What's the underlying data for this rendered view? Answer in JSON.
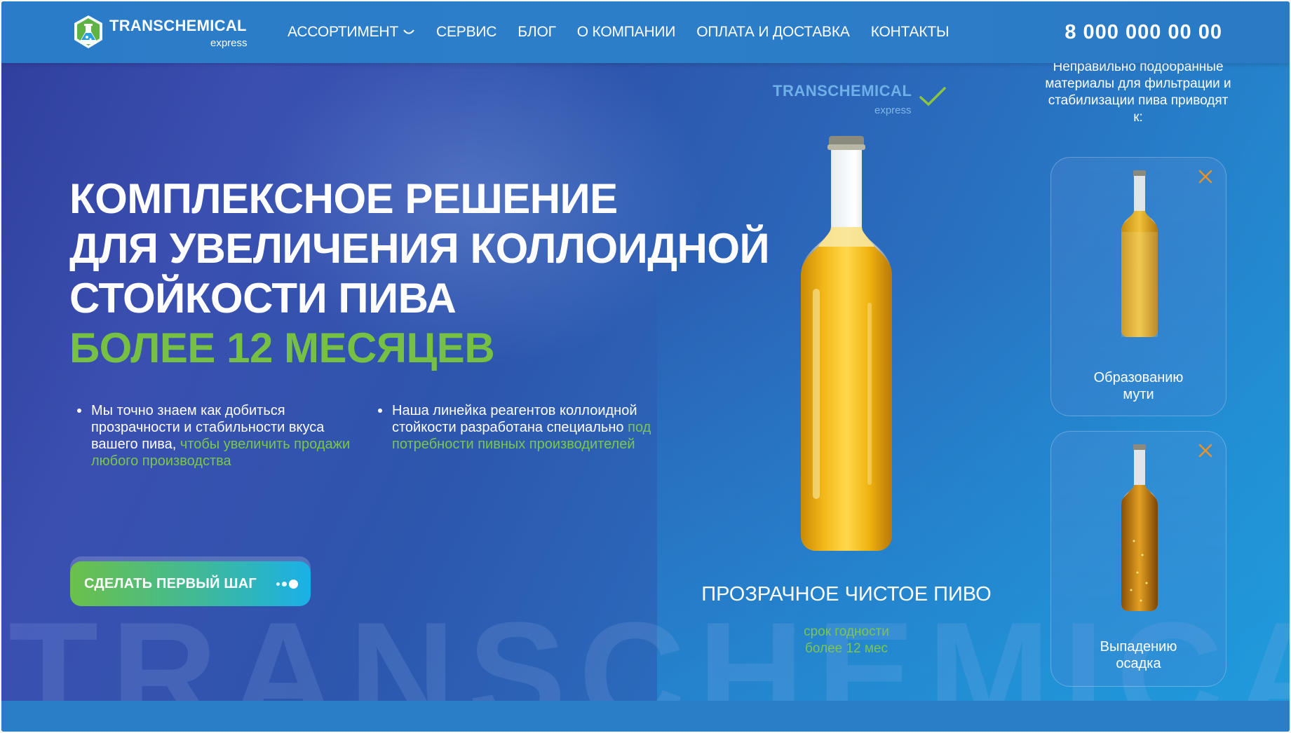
{
  "header": {
    "brand_name": "TRANSCHEMICAL",
    "brand_sub": "express",
    "nav": [
      {
        "label": "АССОРТИМЕНТ"
      },
      {
        "label": "СЕРВИС"
      },
      {
        "label": "БЛОГ"
      },
      {
        "label": "О КОМПАНИИ"
      },
      {
        "label": "ОПЛАТА И ДОСТАВКА"
      },
      {
        "label": "КОНТАКТЫ"
      }
    ],
    "phone": "8 000 000 00 00"
  },
  "hero": {
    "title_lines": [
      "КОМПЛЕКСНОЕ РЕШЕНИЕ",
      "ДЛЯ УВЕЛИЧЕНИЯ КОЛЛОИДНОЙ",
      "СТОЙКОСТИ ПИВА"
    ],
    "title_accent": "БОЛЕЕ 12 МЕСЯЦЕВ",
    "bullet1": {
      "text": "Мы точно знаем как добиться прозрачности и стабильности вкуса вашего пива,",
      "highlight": "чтобы увеличить продажи любого производства"
    },
    "bullet2": {
      "text": "Наша линейка реагентов коллоидной стойкости разработана специально",
      "highlight": "под потребности пивных производителей"
    },
    "cta_label": "СДЕЛАТЬ ПЕРВЫЙ ШАГ",
    "watermark": "TRANSCHEMICAL"
  },
  "product": {
    "brand_name": "TRANSCHEMICAL",
    "brand_sub": "express",
    "caption": "ПРОЗРАЧНОЕ ЧИСТОЕ ПИВО",
    "shelf_line1": "срок годности",
    "shelf_line2": "более 12 мес"
  },
  "problems": {
    "intro": "Неправильно подобранные материалы для фильтрации и стабилизации пива приводят к:",
    "cards": [
      {
        "line1": "Образованию",
        "line2": "мути"
      },
      {
        "line1": "Выпадению",
        "line2": "осадка"
      }
    ]
  },
  "colors": {
    "accent_green": "#76c043",
    "header_blue": "#2b7cc8",
    "warning_orange": "#e8922a"
  }
}
